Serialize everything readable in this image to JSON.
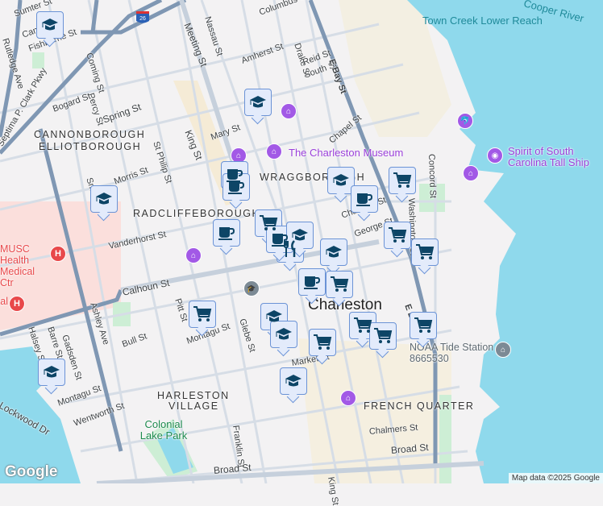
{
  "map": {
    "neighborhoods": [
      "CANNONBOROUGH",
      "ELLIOTBOROUGH",
      "RADCLIFFEBOROUGH",
      "WRAGGBOROUGH",
      "HARLESTON",
      "VILLAGE",
      "FRENCH QUARTER"
    ],
    "city": "Charleston",
    "streets": [
      "Sumter St",
      "Cannon St",
      "Fishburne St",
      "Rutledge Ave",
      "Septima P. Clark Pkwy",
      "Coming St",
      "Percy St",
      "Bogard St",
      "Spring St",
      "King St",
      "Meeting St",
      "Nassau St",
      "Columbus St",
      "Drake St",
      "Amherst St",
      "Reid St",
      "South St",
      "E Bay St",
      "Chapel St",
      "Mary St",
      "St Philip St",
      "Morris St",
      "Smith St",
      "Vanderhorst St",
      "Calhoun St",
      "Pitt St",
      "Glebe St",
      "Montagu St",
      "Bull St",
      "Ashley Ave",
      "Gadsden St",
      "Barre St",
      "Halsey St",
      "Lockwood Dr",
      "Wentworth St",
      "Franklin St",
      "Broad St",
      "Chalmers St",
      "Concord St",
      "Washington St",
      "George St",
      "Market St",
      "Charlotte St",
      "King St"
    ],
    "pois": [
      "The Charleston Museum",
      "Spirit of South Carolina Tall Ship",
      "NOAA Tide Station 8665530",
      "MUSC Health Medical Ctr",
      "Children's Hospital"
    ],
    "water": [
      "Town Creek Lower Reach",
      "Cooper River"
    ],
    "parks": [
      "Colonial Lake Park"
    ],
    "highway_shield": "26",
    "logo": "Google",
    "attribution": "Map data ©2025 Google"
  },
  "markers": [
    "school",
    "school",
    "school",
    "school",
    "school",
    "school",
    "school",
    "school",
    "school",
    "coffee",
    "coffee",
    "coffee",
    "coffee",
    "coffee",
    "grocery",
    "grocery",
    "grocery",
    "grocery",
    "grocery",
    "grocery",
    "grocery",
    "grocery",
    "grocery",
    "restaurant",
    "grocery",
    "coffee",
    "school"
  ],
  "colors": {
    "marker_bg": "#e3ebfb",
    "marker_border": "#6b93d6",
    "marker_icon": "#0d4566",
    "water": "#8fd9ec",
    "poi": "#a259e6",
    "hospital": "#e8484a"
  }
}
